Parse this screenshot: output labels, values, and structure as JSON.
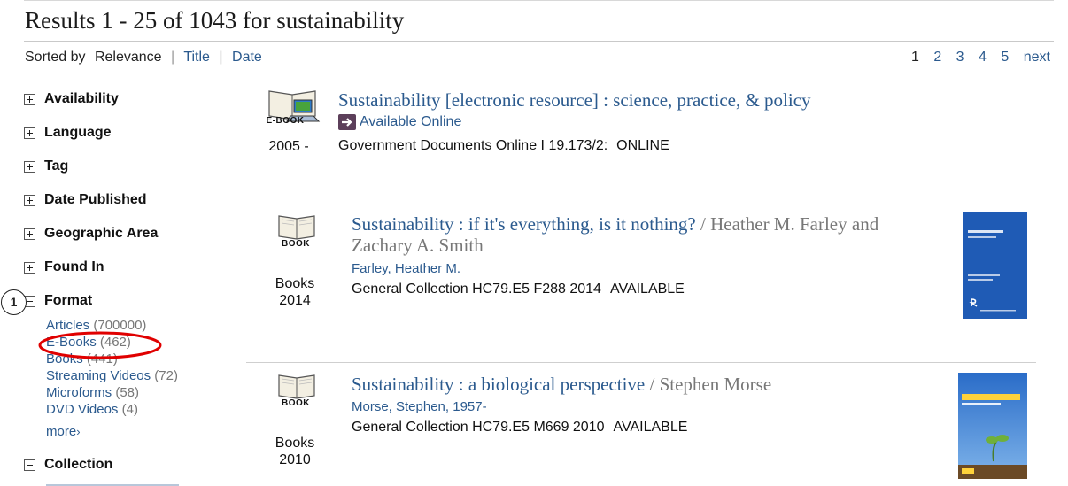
{
  "header": {
    "results_title": "Results 1 - 25 of 1043 for sustainability"
  },
  "sort": {
    "label": "Sorted by",
    "active": "Relevance",
    "options": [
      "Title",
      "Date"
    ]
  },
  "pagination": {
    "current": "1",
    "pages": [
      "2",
      "3",
      "4",
      "5"
    ],
    "next": "next"
  },
  "facets": [
    {
      "label": "Availability",
      "state": "collapsed"
    },
    {
      "label": "Language",
      "state": "collapsed"
    },
    {
      "label": "Tag",
      "state": "collapsed"
    },
    {
      "label": "Date Published",
      "state": "collapsed"
    },
    {
      "label": "Geographic Area",
      "state": "collapsed"
    },
    {
      "label": "Found In",
      "state": "collapsed"
    },
    {
      "label": "Format",
      "state": "expanded"
    },
    {
      "label": "Collection",
      "state": "expanded"
    }
  ],
  "format_values": [
    {
      "label": "Articles",
      "count": "(700000)"
    },
    {
      "label": "E-Books",
      "count": "(462)"
    },
    {
      "label": "Books",
      "count": "(441)"
    },
    {
      "label": "Streaming Videos",
      "count": "(72)"
    },
    {
      "label": "Microforms",
      "count": "(58)"
    },
    {
      "label": "DVD Videos",
      "count": "(4)"
    }
  ],
  "more_label": "more",
  "annotation": {
    "badge": "1",
    "color": "#e00000"
  },
  "results": [
    {
      "icon_caption": "E-BOOK",
      "year": "2005 -",
      "title": "Sustainability [electronic resource] : science, practice, & policy",
      "online_label": "Available Online",
      "holding": "Government Documents Online I 19.173/2:",
      "status": "ONLINE"
    },
    {
      "icon_caption": "BOOK",
      "format": "Books",
      "year": "2014",
      "title": "Sustainability : if it's everything, is it nothing?",
      "responsibility": "/ Heather M. Farley and Zachary A. Smith",
      "author": "Farley, Heather M.",
      "holding": "General Collection HC79.E5 F288 2014",
      "status": "AVAILABLE"
    },
    {
      "icon_caption": "BOOK",
      "format": "Books",
      "year": "2010",
      "title": "Sustainability : a biological perspective",
      "responsibility": "/ Stephen Morse",
      "author": "Morse, Stephen, 1957-",
      "holding": "General Collection HC79.E5 M669 2010",
      "status": "AVAILABLE"
    }
  ],
  "colors": {
    "link": "#2b5a8e",
    "muted": "#777777",
    "cover1": "#1f5bb5",
    "cover2": "#2a6cc8"
  }
}
